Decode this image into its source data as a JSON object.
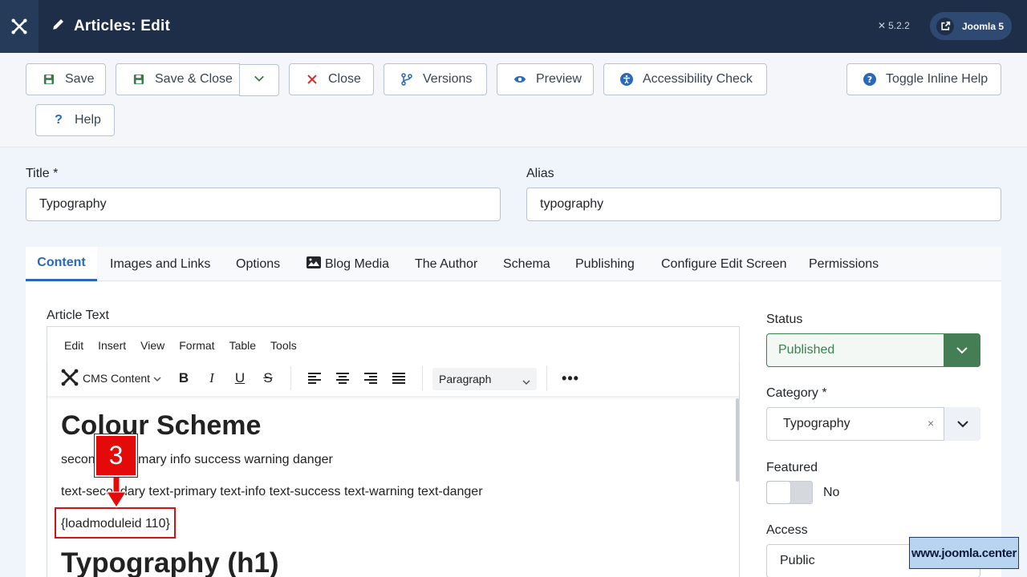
{
  "header": {
    "title": "Articles: Edit",
    "version": "5.2.2",
    "joomla_button": "Joomla 5"
  },
  "toolbar": {
    "save": "Save",
    "save_close": "Save & Close",
    "close": "Close",
    "versions": "Versions",
    "preview": "Preview",
    "accessibility": "Accessibility Check",
    "toggle_help": "Toggle Inline Help",
    "help": "Help"
  },
  "fields": {
    "title_label": "Title *",
    "title_value": "Typography",
    "alias_label": "Alias",
    "alias_value": "typography"
  },
  "tabs": [
    "Content",
    "Images and Links",
    "Options",
    "Blog Media",
    "The Author",
    "Schema",
    "Publishing",
    "Configure Edit Screen",
    "Permissions"
  ],
  "editor": {
    "label": "Article Text",
    "menus": [
      "Edit",
      "Insert",
      "View",
      "Format",
      "Table",
      "Tools"
    ],
    "cms_content": "CMS Content",
    "paragraph": "Paragraph",
    "heading": "Colour Scheme",
    "line1": "secondary primary info success warning danger",
    "line2": "text-secondary text-primary text-info text-success text-warning text-danger",
    "line3": "{loadmoduleid 110}",
    "h1": "Typography (h1)"
  },
  "annotation": {
    "number": "3"
  },
  "sidebar": {
    "status_label": "Status",
    "status_value": "Published",
    "category_label": "Category *",
    "category_value": "Typography",
    "featured_label": "Featured",
    "featured_value": "No",
    "access_label": "Access",
    "access_value": "Public"
  },
  "watermark": "www.joomla.center",
  "colors": {
    "header": "#1e2e49",
    "accent": "#2a69b8",
    "success": "#457d54",
    "annotation": "#e40a0a"
  }
}
